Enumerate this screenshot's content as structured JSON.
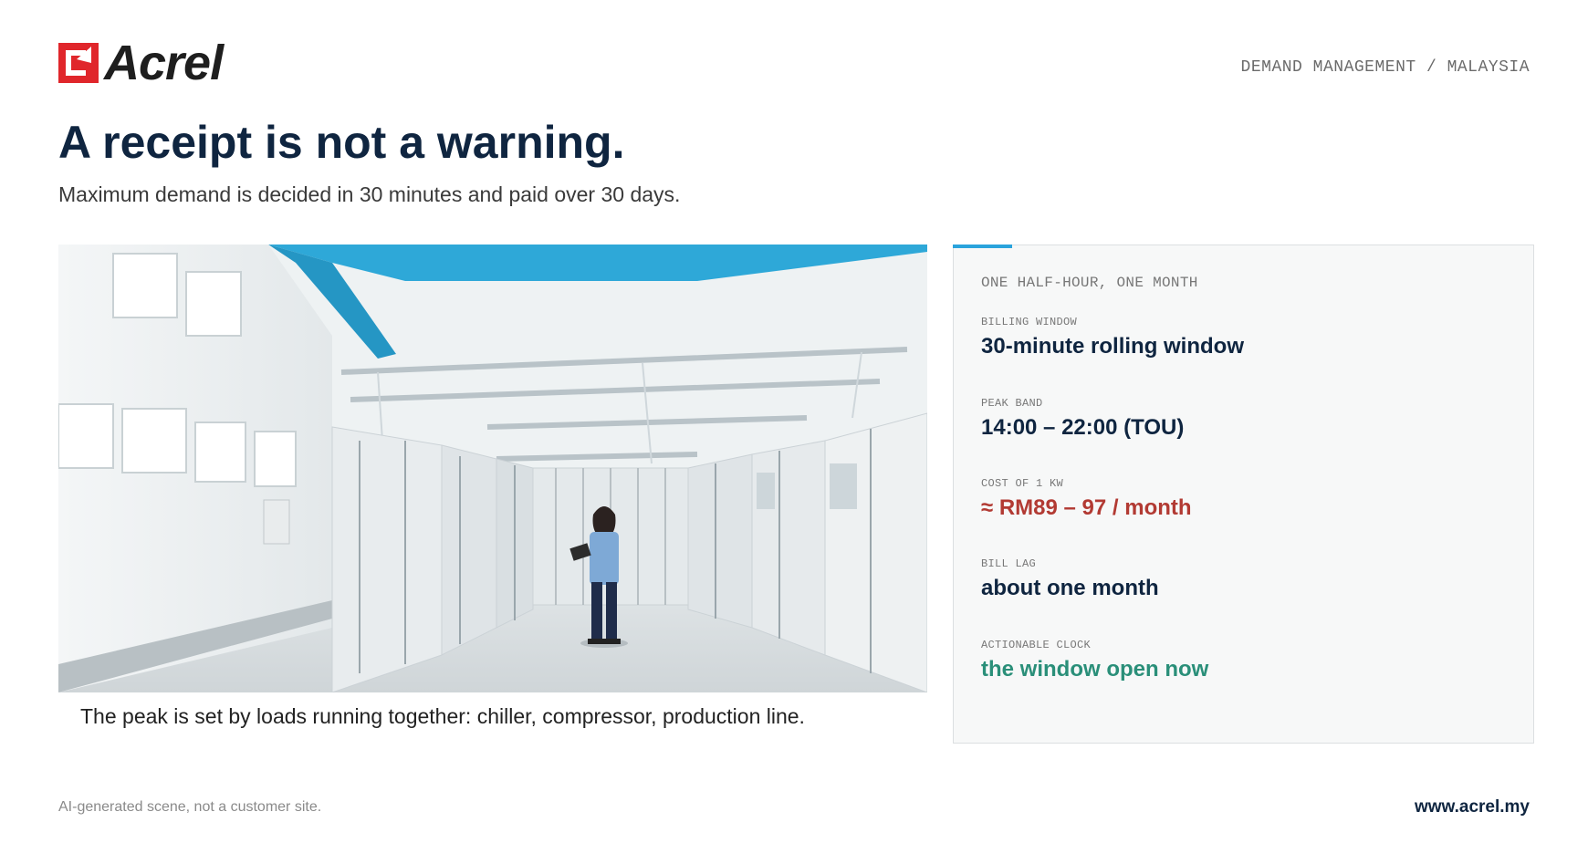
{
  "brand": {
    "name": "Acrel",
    "brand_red": "#e0262b"
  },
  "header": {
    "tagline": "DEMAND MANAGEMENT / MALAYSIA"
  },
  "hero": {
    "headline": "A receipt is not a warning.",
    "subheadline": "Maximum demand is decided in 30 minutes and paid over 30 days."
  },
  "photo": {
    "caption": "The peak is set by loads running together: chiller, compressor, production line."
  },
  "panel": {
    "accent_color": "#2aa3dc",
    "title": "ONE HALF-HOUR, ONE MONTH",
    "items": [
      {
        "label": "BILLING WINDOW",
        "value": "30-minute rolling window",
        "color": "#0f2540"
      },
      {
        "label": "PEAK BAND",
        "value": "14:00 – 22:00 (TOU)",
        "color": "#0f2540"
      },
      {
        "label": "COST OF 1 KW",
        "value": "≈ RM89 – 97 / month",
        "color": "#b23a33"
      },
      {
        "label": "BILL LAG",
        "value": "about one month",
        "color": "#0f2540"
      },
      {
        "label": "ACTIONABLE CLOCK",
        "value": "the window open now",
        "color": "#2a8f79"
      }
    ]
  },
  "footer": {
    "note": "AI-generated scene, not a customer site.",
    "url": "www.acrel.my"
  }
}
